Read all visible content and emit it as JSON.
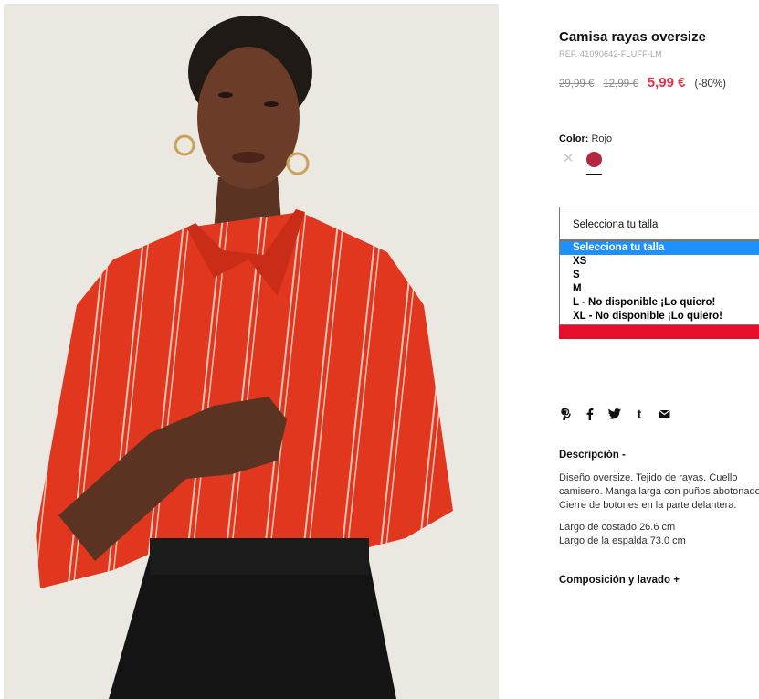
{
  "product": {
    "title": "Camisa rayas oversize",
    "ref": "REF. 41090642-FLUFF-LM",
    "price_original": "29,99 €",
    "price_previous": "12,99 €",
    "price_current": "5,99 €",
    "discount": "(-80%)"
  },
  "color": {
    "label": "Color:",
    "value": "Rojo",
    "swatches": [
      {
        "name": "unavailable",
        "color": "#c8c8c8",
        "selected": false
      },
      {
        "name": "Rojo",
        "color": "#b5263f",
        "selected": true
      }
    ]
  },
  "size": {
    "select_label": "Selecciona tu talla",
    "options": [
      "Selecciona tu talla",
      "XS",
      "S",
      "M",
      "L - No disponible ¡Lo quiero!",
      "XL - No disponible ¡Lo quiero!"
    ],
    "highlighted_index": 0
  },
  "share": {
    "icons": [
      "pinterest-icon",
      "facebook-icon",
      "twitter-icon",
      "tumblr-icon",
      "mail-icon"
    ]
  },
  "description": {
    "title": "Descripción -",
    "body": "Diseño oversize. Tejido de rayas. Cuello camisero. Manga larga con puños abotonados. Cierre de botones en la parte delantera.",
    "measure_1": "Largo de costado 26.6 cm",
    "measure_2": "Largo de la espalda 73.0 cm"
  },
  "composition": {
    "title": "Composición y lavado +"
  },
  "colors": {
    "price_sale": "#e0334a",
    "add_button": "#e60e2a",
    "dropdown_highlight": "#1e90ff",
    "shirt": "#e2371f"
  }
}
